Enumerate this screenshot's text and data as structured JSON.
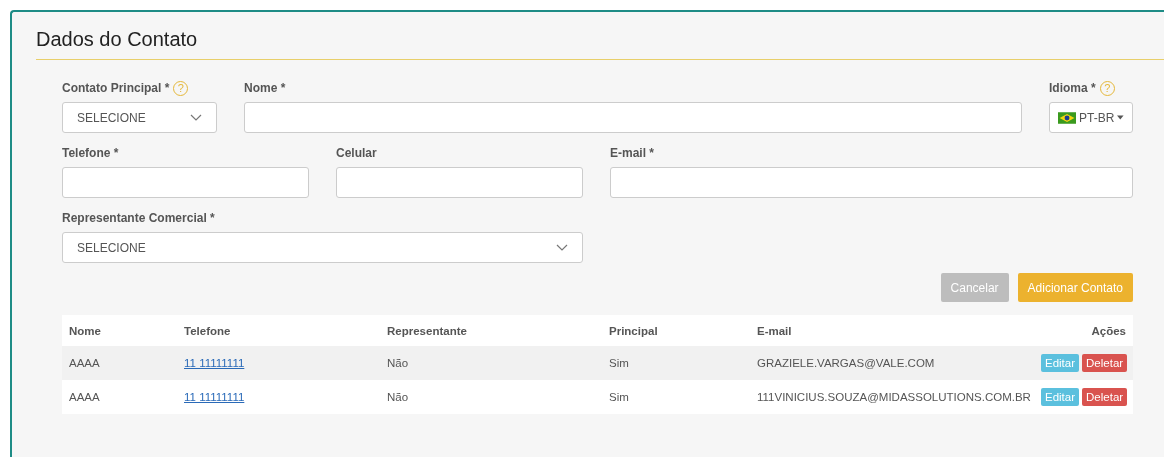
{
  "title": "Dados do Contato",
  "fields": [
    {
      "kind": "select",
      "label": "Contato Principal *",
      "help": "?",
      "value": "SELECIONE"
    },
    {
      "kind": "text",
      "label": "Nome *"
    },
    {
      "kind": "language",
      "label": "Idioma *",
      "help": "?",
      "value": "PT-BR"
    },
    {
      "kind": "text",
      "label": "Telefone *"
    },
    {
      "kind": "text",
      "label": "Celular"
    },
    {
      "kind": "text",
      "label": "E-mail *"
    },
    {
      "kind": "select",
      "label": "Representante Comercial *",
      "value": "SELECIONE"
    }
  ],
  "buttons": [
    {
      "label": "Cancelar",
      "kind": "secondary",
      "disabled": true
    },
    {
      "label": "Adicionar Contato",
      "kind": "primary",
      "disabled": false
    }
  ],
  "table": {
    "columns": [
      "Nome",
      "Telefone",
      "Representante",
      "Principal",
      "E-mail",
      "Ações"
    ],
    "rows": [
      {
        "cells": [
          "AAAA",
          "11 11111111",
          "Não",
          "Sim",
          "GRAZIELE.VARGAS@VALE.COM"
        ],
        "actions": [
          "Editar",
          "Deletar"
        ]
      },
      {
        "cells": [
          "AAAA",
          "11 11111111",
          "Não",
          "Sim",
          "111VINICIUS.SOUZA@MIDASSOLUTIONS.COM.BR"
        ],
        "actions": [
          "Editar",
          "Deletar"
        ]
      }
    ]
  }
}
